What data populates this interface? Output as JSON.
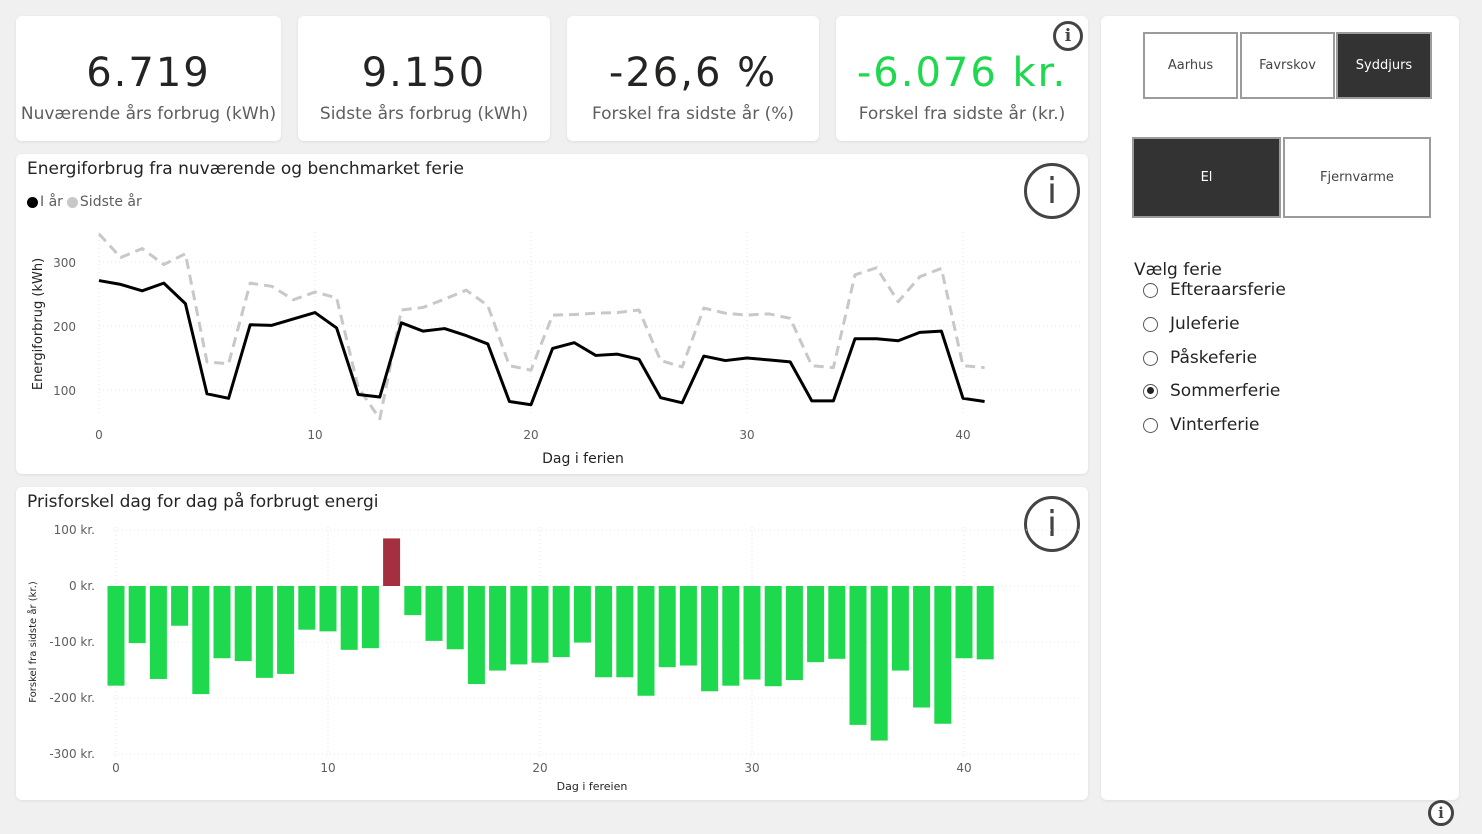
{
  "kpis": [
    {
      "value": "6.719",
      "label": "Nuværende års forbrug (kWh)"
    },
    {
      "value": "9.150",
      "label": "Sidste års forbrug (kWh)"
    },
    {
      "value": "-26,6 %",
      "label": "Forskel fra sidste år (%)"
    },
    {
      "value": "-6.076 kr.",
      "label": "Forskel fra sidste år (kr.)"
    }
  ],
  "info_glyph": "i",
  "icons": {
    "info": "info-circle-icon"
  },
  "colors": {
    "current": "#000000",
    "last": "#c8c8c8",
    "negative_bar": "#1ed84d",
    "positive_bar": "#a4303f",
    "kpi_green": "#1ed84d"
  },
  "slicers": {
    "cities": [
      {
        "label": "Aarhus",
        "selected": false
      },
      {
        "label": "Favrskov",
        "selected": false
      },
      {
        "label": "Syddjurs",
        "selected": true
      }
    ],
    "energy": [
      {
        "label": "El",
        "selected": true
      },
      {
        "label": "Fjernvarme",
        "selected": false
      }
    ],
    "holiday_title": "Vælg ferie",
    "holidays": [
      {
        "label": "Efteraarsferie",
        "selected": false
      },
      {
        "label": "Juleferie",
        "selected": false
      },
      {
        "label": "Påskeferie",
        "selected": false
      },
      {
        "label": "Sommerferie",
        "selected": true
      },
      {
        "label": "Vinterferie",
        "selected": false
      }
    ]
  },
  "chart_data": [
    {
      "type": "line",
      "title": "Energiforbrug fra nuværende og benchmarket ferie",
      "xlabel": "Dag i ferien",
      "ylabel": "Energiforbrug (kWh)",
      "legend": "top-left",
      "xlim": [
        0,
        41
      ],
      "ylim": [
        40,
        350
      ],
      "xticks": [
        0,
        10,
        20,
        30,
        40
      ],
      "yticks": [
        100,
        200,
        300
      ],
      "ytick_labels": [
        "100",
        "200",
        "300"
      ],
      "x": [
        0,
        1,
        2,
        3,
        4,
        5,
        6,
        7,
        8,
        9,
        10,
        11,
        12,
        13,
        14,
        15,
        16,
        17,
        18,
        19,
        20,
        21,
        22,
        23,
        24,
        25,
        26,
        27,
        28,
        29,
        30,
        31,
        32,
        33,
        34,
        35,
        36,
        37,
        38,
        39,
        40,
        41
      ],
      "series": [
        {
          "name": "I år",
          "style": "solid",
          "values": [
            271,
            265,
            255,
            267,
            235,
            94,
            87,
            202,
            201,
            211,
            221,
            197,
            93,
            89,
            205,
            192,
            196,
            185,
            172,
            82,
            77,
            165,
            174,
            154,
            156,
            148,
            88,
            80,
            153,
            146,
            150,
            147,
            144,
            83,
            83,
            180,
            180,
            177,
            190,
            192,
            87,
            82
          ]
        },
        {
          "name": "Sidste år",
          "style": "dashed",
          "values": [
            344,
            307,
            321,
            296,
            313,
            144,
            141,
            267,
            262,
            241,
            253,
            244,
            104,
            55,
            225,
            229,
            242,
            256,
            232,
            138,
            131,
            217,
            218,
            220,
            221,
            225,
            146,
            136,
            228,
            220,
            217,
            219,
            212,
            138,
            135,
            280,
            291,
            238,
            277,
            290,
            138,
            135
          ]
        }
      ]
    },
    {
      "type": "bar",
      "title": "Prisforskel dag for dag på forbrugt energi",
      "xlabel": "Dag i fereien",
      "ylabel": "Forskel fra sidste år (kr.)",
      "xlim": [
        0,
        41
      ],
      "ylim": [
        -300,
        100
      ],
      "xticks": [
        0,
        10,
        20,
        30,
        40
      ],
      "yticks": [
        100,
        0,
        -100,
        -200,
        -300
      ],
      "ytick_labels": [
        "100 kr.",
        "0 kr.",
        "-100 kr.",
        "-200 kr.",
        "-300 kr."
      ],
      "x": [
        0,
        1,
        2,
        3,
        4,
        5,
        6,
        7,
        8,
        9,
        10,
        11,
        12,
        13,
        14,
        15,
        16,
        17,
        18,
        19,
        20,
        21,
        22,
        23,
        24,
        25,
        26,
        27,
        28,
        29,
        30,
        31,
        32,
        33,
        34,
        35,
        36,
        37,
        38,
        39,
        40,
        41
      ],
      "values": [
        -178,
        -102,
        -166,
        -71,
        -193,
        -129,
        -134,
        -164,
        -157,
        -78,
        -81,
        -114,
        -111,
        85,
        -52,
        -98,
        -113,
        -175,
        -151,
        -140,
        -137,
        -127,
        -101,
        -163,
        -163,
        -196,
        -145,
        -142,
        -188,
        -178,
        -167,
        -179,
        -168,
        -136,
        -130,
        -248,
        -276,
        -151,
        -217,
        -246,
        -129,
        -131
      ]
    }
  ]
}
